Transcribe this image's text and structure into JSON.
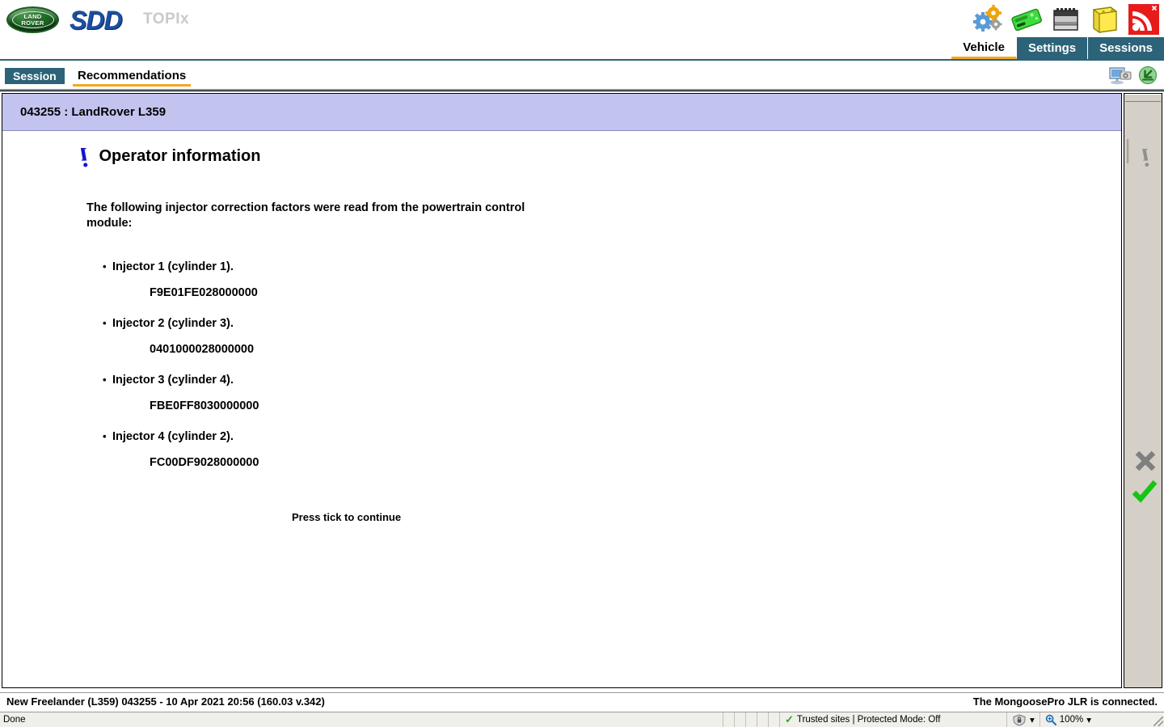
{
  "branding": {
    "marque_top": "LAND",
    "marque_bottom": "ROVER",
    "product": "SDD",
    "portal": "TOPIx"
  },
  "header": {
    "icons": [
      {
        "name": "settings-gears-icon",
        "label": "Settings"
      },
      {
        "name": "vci-device-icon",
        "label": "VCI device"
      },
      {
        "name": "battery-module-icon",
        "label": "Battery"
      },
      {
        "name": "notes-tag-icon",
        "label": "Notes"
      },
      {
        "name": "rss-feed-icon",
        "label": "News feed"
      }
    ],
    "tabs": [
      {
        "label": "Vehicle",
        "active": true
      },
      {
        "label": "Settings",
        "active": false
      },
      {
        "label": "Sessions",
        "active": false
      }
    ]
  },
  "subbar": {
    "session_tab": "Session",
    "recommendations_tab": "Recommendations",
    "icons": [
      {
        "name": "screen-capture-icon",
        "label": "Capture screen"
      },
      {
        "name": "download-import-icon",
        "label": "Import"
      }
    ]
  },
  "vehicle_banner": "043255 : LandRover L359",
  "page": {
    "title": "Operator information",
    "intro": "The following injector correction factors were read from the powertrain control module:",
    "injectors": [
      {
        "label": "Injector 1 (cylinder 1).",
        "value": "F9E01FE028000000"
      },
      {
        "label": "Injector 2 (cylinder 3).",
        "value": "0401000028000000"
      },
      {
        "label": "Injector 3 (cylinder 4).",
        "value": "FBE0FF8030000000"
      },
      {
        "label": "Injector 4 (cylinder 2).",
        "value": "FC00DF9028000000"
      }
    ],
    "prompt": "Press tick to continue"
  },
  "tool_rail": {
    "info_label": "Information",
    "cancel_label": "Cancel",
    "confirm_label": "Confirm"
  },
  "footer": {
    "session_line": "New Freelander (L359) 043255 - 10 Apr 2021 20:56 (160.03 v.342)",
    "device_status": "The MongoosePro JLR is connected."
  },
  "browser_status": {
    "load_state": "Done",
    "security_zone": "Trusted sites | Protected Mode: Off",
    "zoom_level": "100%"
  },
  "colors": {
    "nav_teal": "#2c6378",
    "accent_orange": "#f5a623",
    "banner_lilac": "#c3c3f0",
    "rail_gray": "#d4d0c8",
    "tick_green": "#16c416",
    "rss_red": "#e81b1b"
  }
}
